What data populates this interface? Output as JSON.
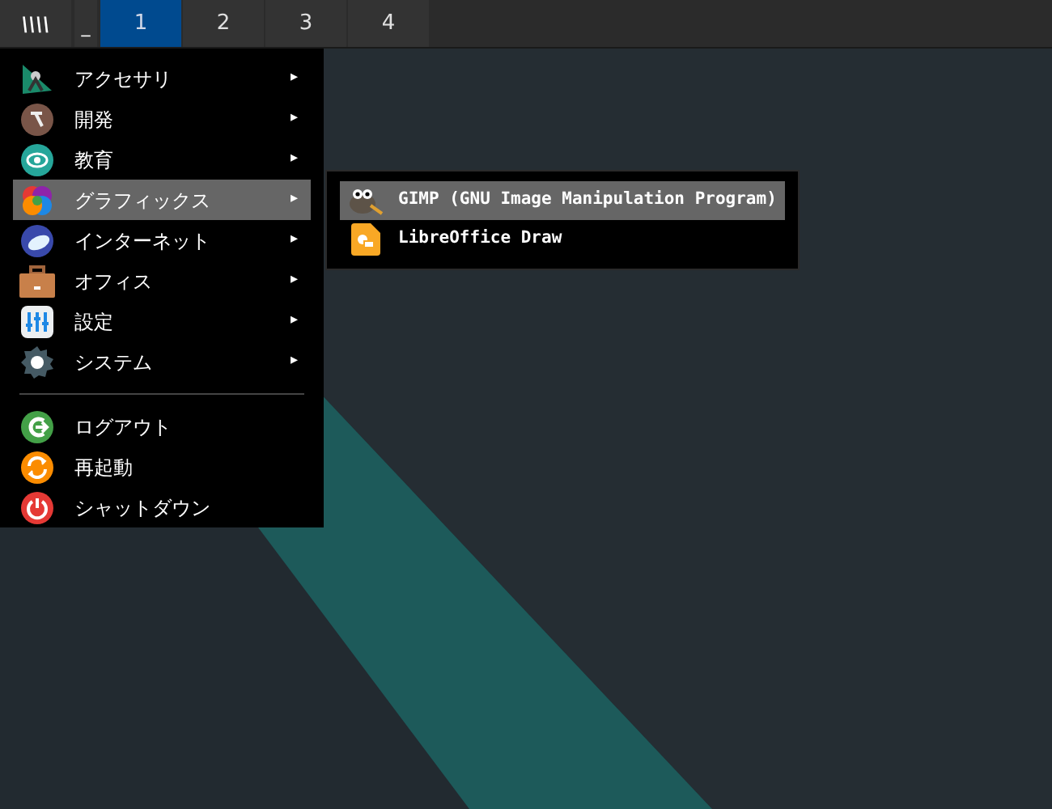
{
  "taskbar": {
    "menu_button": "\\\\\\\\",
    "minimize_button": "_",
    "workspaces": [
      {
        "label": "1",
        "selected": true
      },
      {
        "label": "2",
        "selected": false
      },
      {
        "label": "3",
        "selected": false
      },
      {
        "label": "4",
        "selected": false
      }
    ]
  },
  "menu": {
    "items": [
      {
        "label": "アクセサリ",
        "kind": "submenu",
        "selected": false,
        "arrow": "▸"
      },
      {
        "label": "開発",
        "kind": "submenu",
        "selected": false,
        "arrow": "▸"
      },
      {
        "label": "教育",
        "kind": "submenu",
        "selected": false,
        "arrow": "▸"
      },
      {
        "label": "グラフィックス",
        "kind": "submenu",
        "selected": true,
        "arrow": "▸"
      },
      {
        "label": "インターネット",
        "kind": "submenu",
        "selected": false,
        "arrow": "▸"
      },
      {
        "label": "オフィス",
        "kind": "submenu",
        "selected": false,
        "arrow": "▸"
      },
      {
        "label": "設定",
        "kind": "submenu",
        "selected": false,
        "arrow": "▸"
      },
      {
        "label": "システム",
        "kind": "submenu",
        "selected": false,
        "arrow": "▸"
      },
      {
        "kind": "separator"
      },
      {
        "label": "ログアウト",
        "kind": "action",
        "selected": false
      },
      {
        "label": "再起動",
        "kind": "action",
        "selected": false
      },
      {
        "label": "シャットダウン",
        "kind": "action",
        "selected": false
      }
    ]
  },
  "submenu": {
    "items": [
      {
        "label": "GIMP (GNU Image Manipulation Program)",
        "selected": true
      },
      {
        "label": "LibreOffice Draw",
        "selected": false
      }
    ]
  }
}
